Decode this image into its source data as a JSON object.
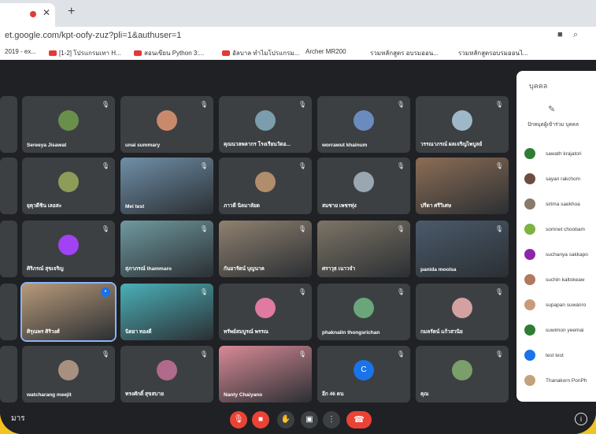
{
  "browser": {
    "url": "et.google.com/kpt-oofy-zuz?pli=1&authuser=1",
    "bookmarks": [
      "2019 - ex...",
      "[1-2] โปรแกรมเทา H...",
      "สอนเขียน Python 3:...",
      "อัลบาล ทำไมโปรแกรม...",
      "Archer MR200",
      "รวมหลักสูตร อบรมออน...",
      "รวมหลักสูตรอบรมออนไ..."
    ]
  },
  "tiles": [
    {
      "name": "Sereeya Jisawat",
      "type": "avatar",
      "color": "#6a8f4a"
    },
    {
      "name": "unai summary",
      "type": "avatar",
      "color": "#c98a6b"
    },
    {
      "name": "คุณนวลพลากร โรงเรียนวัดอ...",
      "type": "avatar",
      "color": "#7b9dad"
    },
    {
      "name": "worrawut khainum",
      "type": "avatar",
      "color": "#6b8bbf"
    },
    {
      "name": "วรรณาภรณ์ ผลเจริญไพบูลย์",
      "type": "avatar",
      "color": "#9eb8c9"
    },
    {
      "name": "ยุคุวดีชิน เลอสะ",
      "type": "avatar",
      "color": "#8e9c5a"
    },
    {
      "name": "Mei test",
      "type": "video",
      "color": "#6f8fa8"
    },
    {
      "name": "ภาวดี นิลมาลัยด",
      "type": "avatar",
      "color": "#b08d6b"
    },
    {
      "name": "สมชาย เพชรทุ่ง",
      "type": "avatar",
      "color": "#9aa6b0"
    },
    {
      "name": "ปรีดา ศรีวิเศษ",
      "type": "video",
      "color": "#8c6d55"
    },
    {
      "name": "ศิริภรณ์ สุขเจริญ",
      "type": "letter",
      "color": "#a142f4"
    },
    {
      "name": "สุภาภรณ์ thammaro",
      "type": "video",
      "color": "#6f9aa0"
    },
    {
      "name": "กันยารัตน์ บุญนาค",
      "type": "video",
      "color": "#8f8170"
    },
    {
      "name": "ศราวุธ เนาวจำ",
      "type": "video",
      "color": "#7d7466"
    },
    {
      "name": "panida moolsa",
      "type": "video",
      "color": "#4a5a6b"
    },
    {
      "name": "ศิรุณพร ศิริวงศ์",
      "type": "video",
      "color": "#b89a7a"
    },
    {
      "name": "นิตยา ทองดี",
      "type": "video",
      "color": "#4ab0b8"
    },
    {
      "name": "ทรัพย์สมบูรณ์ พรรณ",
      "type": "avatar",
      "color": "#e07aa0"
    },
    {
      "name": "phaknalin thongsrichan",
      "type": "avatar",
      "color": "#6aa67a"
    },
    {
      "name": "กมลรัตน์ แก้วสวนิย",
      "type": "avatar",
      "color": "#d4a0a0"
    },
    {
      "name": "watcharang meejit",
      "type": "avatar",
      "color": "#a89080"
    },
    {
      "name": "ทรงศักดิ์ สุขสบาย",
      "type": "avatar",
      "color": "#b06a8a"
    },
    {
      "name": "Nanty Chaiyano",
      "type": "video",
      "color": "#d88a96"
    },
    {
      "name": "อีก 46 คน",
      "type": "more",
      "color": "#1a73e8"
    },
    {
      "name": "คุณ",
      "type": "avatar",
      "color": "#7a9f6a"
    }
  ],
  "panel": {
    "title": "บุคคล",
    "subtitle": "ปักหมุดผู้เข้าร่วม บุคคล",
    "people": [
      {
        "name": "sawath krajatori",
        "color": "#2e7d32"
      },
      {
        "name": "sayan rakchom",
        "color": "#6d4c41"
      },
      {
        "name": "sirima saekhoa",
        "color": "#8a7a6a"
      },
      {
        "name": "somnet choobam",
        "color": "#7cb342"
      },
      {
        "name": "suchanya sakkapo",
        "color": "#8e24aa"
      },
      {
        "name": "suchin kaltokeaw",
        "color": "#b07a60"
      },
      {
        "name": "supapan suwanro",
        "color": "#c99a7a"
      },
      {
        "name": "suwimon yeemai",
        "color": "#2e7d32"
      },
      {
        "name": "test test",
        "color": "#1a73e8"
      },
      {
        "name": "Thanakorn PonPh",
        "color": "#c4a37a"
      }
    ]
  },
  "bottom": {
    "meeting_label": "มาร"
  }
}
